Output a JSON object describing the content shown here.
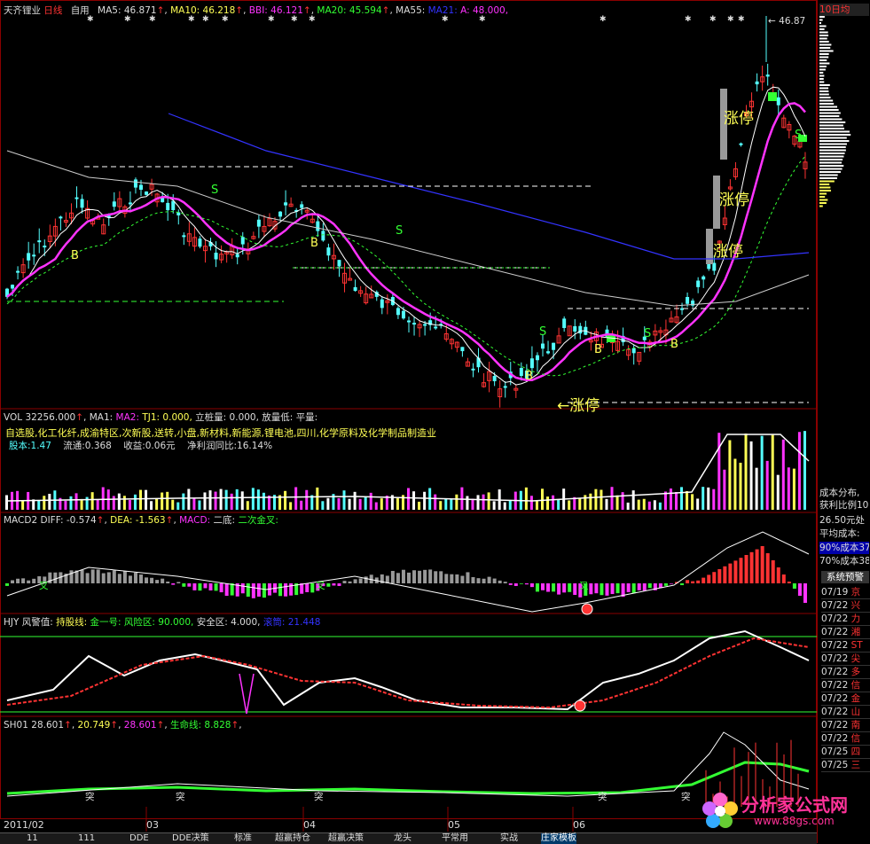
{
  "main_chart": {
    "stock_name": "天齐锂业",
    "period": "日线",
    "mode": "自用",
    "ma5": "MA5: 46.871",
    "ma10": "MA10: 46.218",
    "bbi": "BBI: 46.121",
    "ma20": "MA20: 45.594",
    "ma55": "MA55:",
    "ma21": "MA21:",
    "a_val": "A: 48.000,",
    "price_high": "46.87",
    "limit_up_label": "涨停",
    "buy_label": "B",
    "sell_label": "S"
  },
  "vol_panel": {
    "vol": "VOL 32256.000",
    "ma1": "MA1:",
    "ma2": "MA2:",
    "tj1": "TJ1: 0.000,",
    "vol_stand": "立桩量: 0.000,",
    "vol_low": "放量低:",
    "flat_vol": "平量:",
    "concepts": "自选股,化工化纤,成渝特区,次新股,送转,小盘,新材料,新能源,锂电池,四川,化学原料及化学制品制造业",
    "share_capital": "股本:1.47",
    "float": "流通:0.368",
    "eps": "收益:0.06元",
    "profit_yoy": "净利润同比:16.14%"
  },
  "macd_panel": {
    "name": "MACD2",
    "diff": "DIFF: -0.574",
    "dea": "DEA: -1.563",
    "macd": "MACD:",
    "second_bottom": "二底:",
    "second_cross": "二次金叉:",
    "cross_label": "叉"
  },
  "hjy_panel": {
    "name": "HJY 风警值:",
    "hold_line": "持股线:",
    "gold_one": "金一号:",
    "risk_zone": "风险区: 90.000,",
    "safe_zone": "安全区: 4.000,",
    "sub_title": "滚筒: 21.448"
  },
  "sh01_panel": {
    "name": "SH01",
    "v1": "28.601",
    "v2": "20.749",
    "v3": "28.601",
    "life_line": "生命线: 8.828",
    "break_label": "突"
  },
  "date_axis": [
    "2011/02",
    "03",
    "04",
    "05",
    "06"
  ],
  "bottom_tabs": [
    "11",
    "111",
    "DDE",
    "DDE决策",
    "标准",
    "超赢持仓",
    "超赢决策",
    "龙头",
    "平常用",
    "实战",
    "庄家模板"
  ],
  "right_panel": {
    "header": "10日均",
    "cost_title": "成本分布,",
    "profit_ratio": "获利比例10",
    "avg_price": "26.50元处",
    "avg_cost": "平均成本:",
    "cost90": "90%成本37",
    "cost70": "70%成本38",
    "warn_title": "系统预警",
    "warnings": [
      {
        "date": "07/19",
        "name": "京",
        "color": "#ff3333"
      },
      {
        "date": "07/22",
        "name": "兴",
        "color": "#ff3333"
      },
      {
        "date": "07/22",
        "name": "力",
        "color": "#ff3333"
      },
      {
        "date": "07/22",
        "name": "湘",
        "color": "#ff3333"
      },
      {
        "date": "07/22",
        "name": "ST",
        "color": "#ff3333"
      },
      {
        "date": "07/22",
        "name": "尖",
        "color": "#ff3333"
      },
      {
        "date": "07/22",
        "name": "多",
        "color": "#ff3333"
      },
      {
        "date": "07/22",
        "name": "信",
        "color": "#ff3333"
      },
      {
        "date": "07/22",
        "name": "金",
        "color": "#ff3333"
      },
      {
        "date": "07/22",
        "name": "山",
        "color": "#ff3333"
      },
      {
        "date": "07/22",
        "name": "南",
        "color": "#ff3333"
      },
      {
        "date": "07/22",
        "name": "信",
        "color": "#ff3333"
      },
      {
        "date": "07/25",
        "name": "四",
        "color": "#ff3333"
      },
      {
        "date": "07/25",
        "name": "三",
        "color": "#ff3333"
      }
    ]
  },
  "watermark": {
    "brand": "分析家公式网",
    "url": "www.88gs.com"
  },
  "colors": {
    "background": "#000000",
    "up": "#ff3333",
    "down": "#54ffff",
    "ma_magenta": "#ff33ff",
    "ma_blue": "#3333ff",
    "ma_white": "#ffffff",
    "green": "#33ff33",
    "yellow": "#ffff55"
  }
}
